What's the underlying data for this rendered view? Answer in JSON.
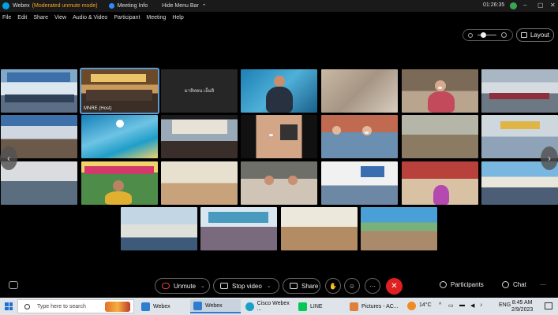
{
  "titlebar": {
    "app_name": "Webex",
    "mode": "(Moderated unmute mode)",
    "meeting_info": "Meeting Info",
    "hide_menu": "Hide Menu Bar",
    "time": "01:26:35",
    "minimize": "–",
    "maximize": "▢",
    "close": "✕"
  },
  "menu": [
    "File",
    "Edit",
    "Share",
    "View",
    "Audio & Video",
    "Participant",
    "Meeting",
    "Help"
  ],
  "toolbar": {
    "layout_label": "Layout"
  },
  "tiles": [
    {
      "name": ""
    },
    {
      "name": "MNRE (Host)"
    },
    {
      "name": "มาลิทอน เอ็มอิ"
    },
    {
      "name": ""
    },
    {
      "name": ""
    },
    {
      "name": ""
    },
    {
      "name": ""
    },
    {
      "name": ""
    },
    {
      "name": ""
    },
    {
      "name": ""
    },
    {
      "name": ""
    },
    {
      "name": ""
    },
    {
      "name": ""
    },
    {
      "name": ""
    },
    {
      "name": ""
    },
    {
      "name": ""
    },
    {
      "name": ""
    },
    {
      "name": ""
    },
    {
      "name": ""
    },
    {
      "name": ""
    },
    {
      "name": ""
    },
    {
      "name": ""
    },
    {
      "name": ""
    },
    {
      "name": ""
    },
    {
      "name": ""
    }
  ],
  "controls": {
    "unmute": "Unmute",
    "stop_video": "Stop video",
    "share": "Share",
    "more": "···",
    "participants": "Participants",
    "chat": "Chat",
    "overflow": "···"
  },
  "taskbar": {
    "search_placeholder": "Type here to search",
    "tasks": [
      "Webex",
      "Webex",
      "Cisco Webex ...",
      "LINE",
      "Pictures - AC..."
    ],
    "weather": "14°C",
    "lang": "ENG",
    "time": "8:45 AM",
    "date": "2/9/2023"
  },
  "colors": {
    "accent": "#2d8cff",
    "end_call": "#e02020",
    "mode_text": "#f5a623"
  }
}
